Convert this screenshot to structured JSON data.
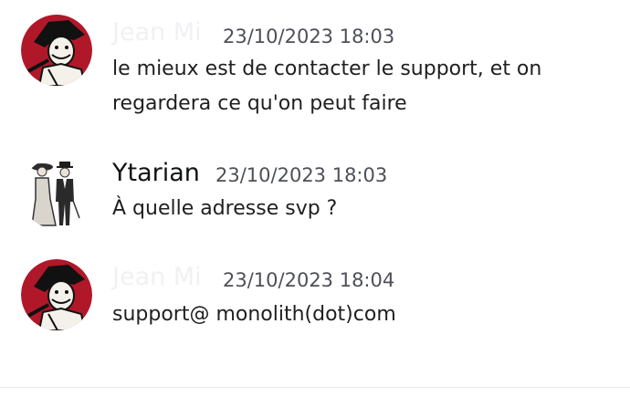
{
  "colors": {
    "background": "#ffffff",
    "username_ghost": "#f1f1f3",
    "username_dark": "#111214",
    "timestamp": "#4e5058",
    "text": "#1f1f22",
    "avatar_red": "#b0182a"
  },
  "messages": [
    {
      "author": "Jean Mi",
      "timestamp": "23/10/2023 18:03",
      "text": "le mieux est de contacter le support, et on regardera ce qu'on peut faire",
      "avatar_icon": "red-caricature-avatar"
    },
    {
      "author": "Ytarian",
      "timestamp": "23/10/2023 18:03",
      "text": "À quelle adresse svp ?",
      "avatar_icon": "vintage-couple-avatar"
    },
    {
      "author": "Jean Mi",
      "timestamp": "23/10/2023 18:04",
      "text": "support@  monolith(dot)com",
      "avatar_icon": "red-caricature-avatar"
    }
  ]
}
